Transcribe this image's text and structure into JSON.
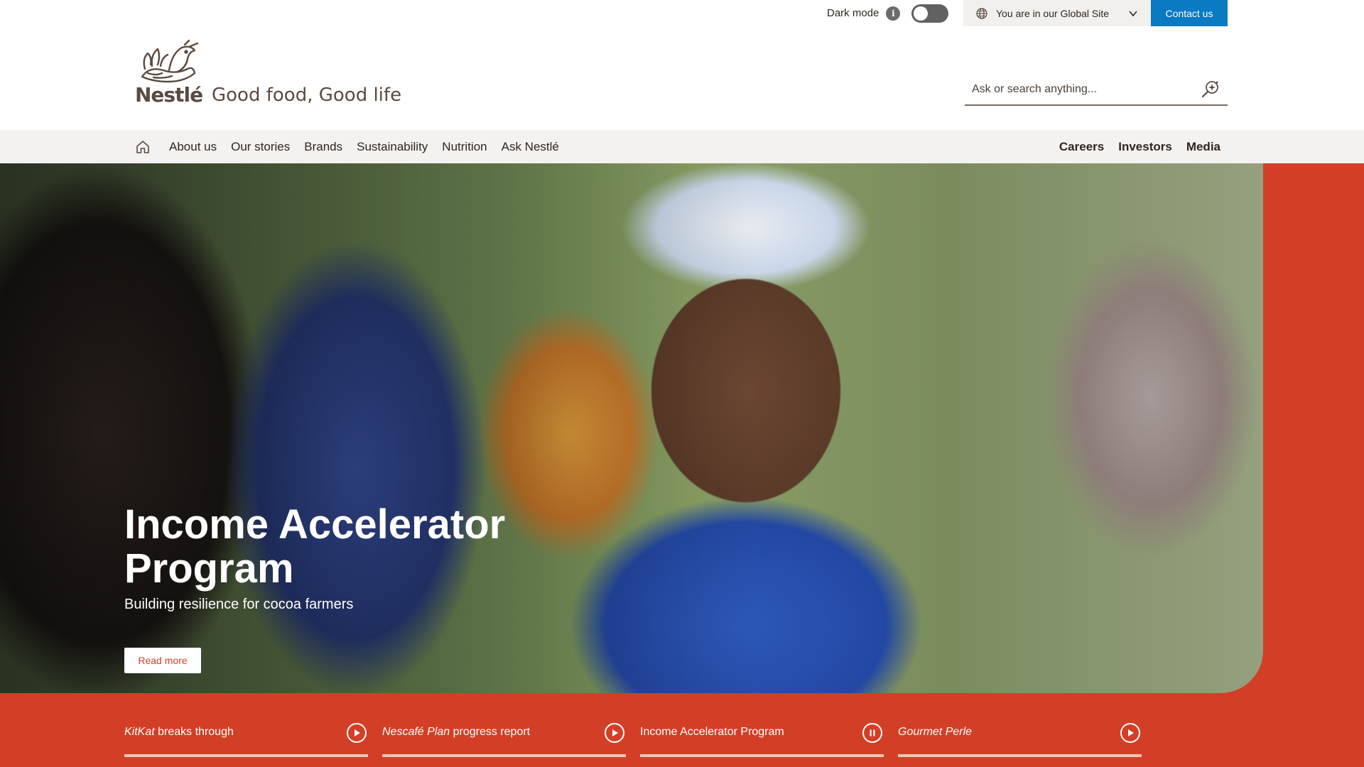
{
  "utility": {
    "dark_mode_label": "Dark mode",
    "info_symbol": "i",
    "dark_mode_on": false,
    "site_selector_label": "You are in our Global Site",
    "contact_label": "Contact us"
  },
  "header": {
    "brand_name": "Nestlé",
    "tagline": "Good food, Good life",
    "search_placeholder": "Ask or search anything..."
  },
  "nav": {
    "primary": [
      "About us",
      "Our stories",
      "Brands",
      "Sustainability",
      "Nutrition",
      "Ask Nestlé"
    ],
    "secondary": [
      "Careers",
      "Investors",
      "Media"
    ]
  },
  "hero": {
    "title": "Income Accelerator Program",
    "subtitle": "Building resilience for cocoa farmers",
    "cta_label": "Read more"
  },
  "story_tabs": [
    {
      "label_em": "KitKat",
      "label_rest": " breaks through",
      "state": "play",
      "progress": 1.0
    },
    {
      "label_em": "Nescafé Plan",
      "label_rest": " progress report",
      "state": "play",
      "progress": 1.0
    },
    {
      "label_em": "",
      "label_rest": "Income Accelerator Program",
      "state": "pause",
      "progress": 1.0
    },
    {
      "label_em": "Gourmet Perle",
      "label_rest": "",
      "state": "play",
      "progress": 1.0
    }
  ],
  "colors": {
    "brand_red": "#d33f26",
    "contact_blue": "#0a7ac2",
    "text_brown": "#30261d"
  }
}
